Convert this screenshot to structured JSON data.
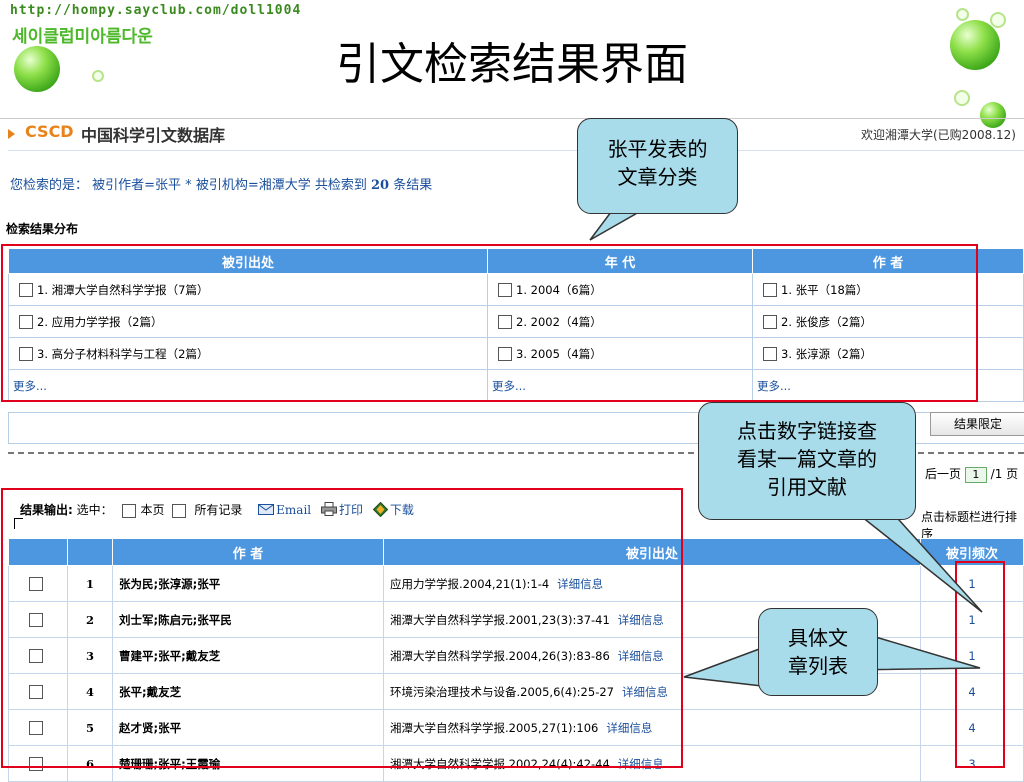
{
  "banner": {
    "url": "http://hompy.sayclub.com/doll1004",
    "korean": "세이클럽미아름다운"
  },
  "slide_title": "引文检索结果界面",
  "header": {
    "brand": "CSCD",
    "name": "中国科学引文数据库",
    "welcome": "欢迎湘潭大学(已购2008.12)"
  },
  "query": {
    "prefix": "您检索的是：",
    "condition": "被引作者=张平 * 被引机构=湘潭大学",
    "found_prefix": "共检索到",
    "count": "20",
    "found_suffix": "条结果"
  },
  "distribution": {
    "label": "检索结果分布",
    "columns": [
      "被引出处",
      "年 代",
      "作 者"
    ],
    "rows": [
      [
        "1. 湘潭大学自然科学学报（7篇）",
        "1. 2004（6篇）",
        "1. 张平（18篇）"
      ],
      [
        "2. 应用力学学报（2篇）",
        "2. 2002（4篇）",
        "2. 张俊彦（2篇）"
      ],
      [
        "3. 高分子材料科学与工程（2篇）",
        "3. 2005（4篇）",
        "3. 张淳源（2篇）"
      ]
    ],
    "more": [
      "更多...",
      "更多...",
      "更多..."
    ]
  },
  "limit_button": "结果限定",
  "pager": {
    "prefix": "后一页",
    "page": "1",
    "suffix": "/1 页"
  },
  "sort_hint": "点击标题栏进行排序",
  "output": {
    "label": "结果输出:",
    "select": "选中：",
    "this_page": "本页",
    "all": "所有记录",
    "email": "Email",
    "print": "打印",
    "download": "下载"
  },
  "results": {
    "columns": [
      "",
      "",
      "作 者",
      "被引出处",
      "被引频次"
    ],
    "rows": [
      {
        "no": "1",
        "authors": "张为民;张淳源;张平",
        "source": "应用力学学报.2004,21(1):1-4",
        "detail": "详细信息",
        "count": "1"
      },
      {
        "no": "2",
        "authors": "刘士军;陈启元;张平民",
        "source": "湘潭大学自然科学学报.2001,23(3):37-41",
        "detail": "详细信息",
        "count": "1"
      },
      {
        "no": "3",
        "authors": "曹建平;张平;戴友芝",
        "source": "湘潭大学自然科学学报.2004,26(3):83-86",
        "detail": "详细信息",
        "count": "1"
      },
      {
        "no": "4",
        "authors": "张平;戴友芝",
        "source": "环境污染治理技术与设备.2005,6(4):25-27",
        "detail": "详细信息",
        "count": "4"
      },
      {
        "no": "5",
        "authors": "赵才贤;张平",
        "source": "湘潭大学自然科学学报.2005,27(1):106",
        "detail": "详细信息",
        "count": "4"
      },
      {
        "no": "6",
        "authors": "楚珊珊;张平;王霞瑜",
        "source": "湘潭大学自然科学学报.2002,24(4):42-44",
        "detail": "详细信息",
        "count": "3"
      }
    ]
  },
  "callouts": {
    "category": "张平发表的\n文章分类",
    "citation": "点击数字链接查\n看某一篇文章的\n引用文献",
    "list": "具体文\n章列表"
  },
  "colors": {
    "header_blue": "#4d97e0",
    "highlight_red": "#e0001b",
    "callout": "#a9dcea",
    "brand_orange": "#e8821a"
  }
}
